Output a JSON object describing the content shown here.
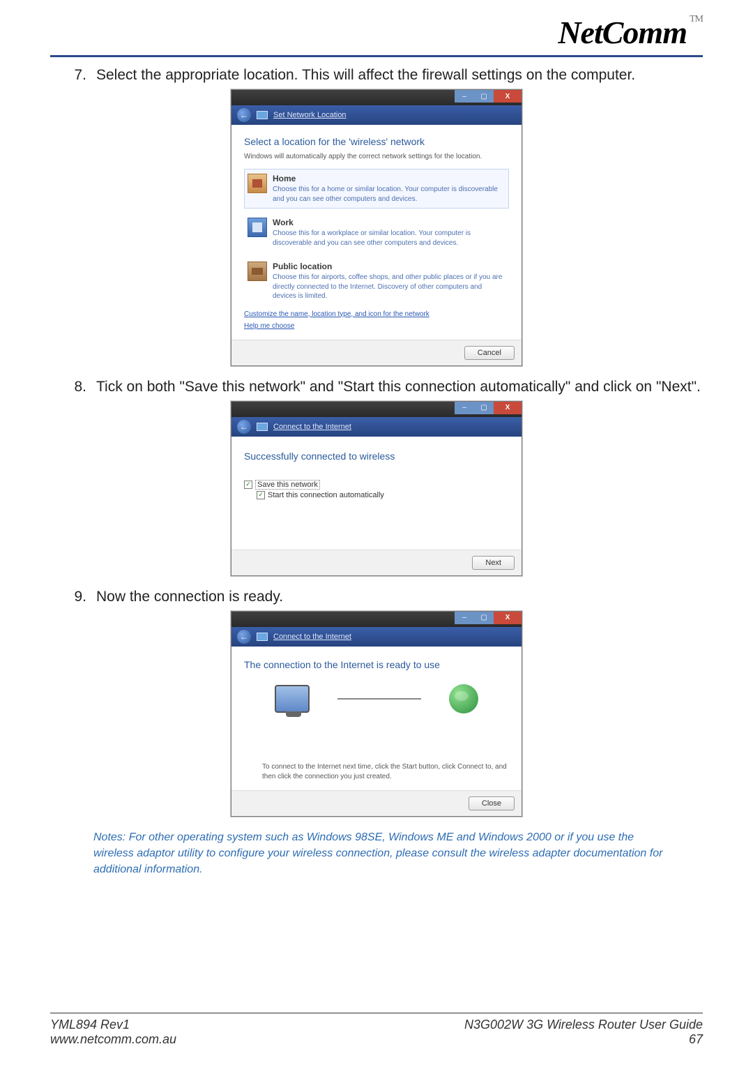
{
  "brand": {
    "name": "NetComm",
    "tm": "TM"
  },
  "steps": [
    {
      "num": "7.",
      "text": "Select the appropriate location. This will affect the firewall settings on the computer."
    },
    {
      "num": "8.",
      "text": "Tick on both \"Save this network\" and  \"Start this connection automatically\" and click on \"Next\"."
    },
    {
      "num": "9.",
      "text": "Now the connection is ready."
    }
  ],
  "dialog1": {
    "crumb_title": "Set Network Location",
    "heading": "Select a location for the 'wireless' network",
    "sub": "Windows will automatically apply the correct network settings for the location.",
    "options": [
      {
        "title": "Home",
        "desc": "Choose this for a home or similar location. Your computer is discoverable and you can see other computers and devices."
      },
      {
        "title": "Work",
        "desc": "Choose this for a workplace or similar location. Your computer is discoverable and you can see other computers and devices."
      },
      {
        "title": "Public location",
        "desc": "Choose this for airports, coffee shops, and other public places or if you are directly connected to the Internet. Discovery of other computers and devices is limited."
      }
    ],
    "link_customize": "Customize the name, location type, and icon for the network",
    "link_help": "Help me choose",
    "cancel": "Cancel"
  },
  "dialog2": {
    "crumb_title": "Connect to the Internet",
    "heading": "Successfully connected to wireless",
    "save_label": "Save this network",
    "start_label": "Start this connection automatically",
    "next": "Next"
  },
  "dialog3": {
    "crumb_title": "Connect to the Internet",
    "heading": "The connection to the Internet is ready to use",
    "hint": "To connect to the Internet next time, click the Start button, click Connect to, and then click the connection you just created.",
    "close": "Close"
  },
  "notes": "Notes: For other operating system such as Windows 98SE, Windows ME and Windows 2000 or if you use the wireless adaptor utility to configure your wireless connection, please consult the wireless adapter documentation for additional information.",
  "footer": {
    "left_top": "YML894 Rev1",
    "left_bottom": "www.netcomm.com.au",
    "right_top": "N3G002W 3G Wireless Router User Guide",
    "right_bottom": "67"
  },
  "win_icons": {
    "min": "–",
    "max": "▢",
    "close": "X"
  }
}
